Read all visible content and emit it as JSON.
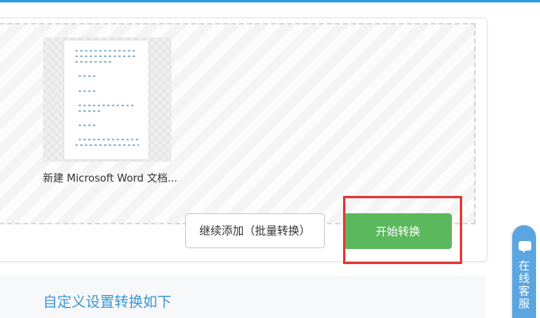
{
  "file": {
    "name": "新建 Microsoft Word 文档..."
  },
  "actions": {
    "add_more_label": "继续添加（批量转换）",
    "start_label": "开始转换"
  },
  "settings": {
    "title": "自定义设置转换如下"
  },
  "chat": {
    "label": "在线客服",
    "icon": "chat-bubble-icon"
  },
  "colors": {
    "accent_blue": "#2d9de0",
    "start_green": "#5cb85c",
    "highlight_red": "#e53935",
    "settings_title": "#3b97d3",
    "chat_tab": "#5ba6e0"
  }
}
